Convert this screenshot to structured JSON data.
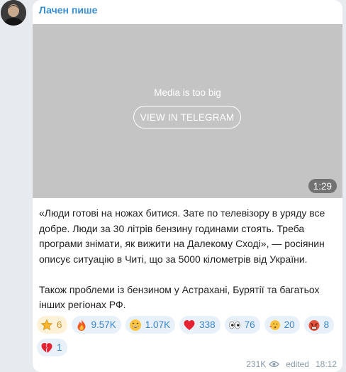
{
  "channel": {
    "name": "Лачен пише"
  },
  "media": {
    "notice": "Media is too big",
    "button_label": "VIEW IN TELEGRAM",
    "duration": "1:29"
  },
  "post": {
    "paragraph_1": "«Люди готові на ножах битися. Зате по телевізору в уряду все добре. Люди за 30 літрів бензину годинами стоять. Треба програми знімати, як вижити на Далекому Сході», — росіянин описує ситуацію в Читі, що за 5000 кілометрів від України.",
    "paragraph_2": "Також проблеми із бензином у Астрахані, Бурятії та багатьох інших регіонах РФ."
  },
  "reactions": [
    {
      "icon": "star-icon",
      "count": "6"
    },
    {
      "icon": "fire-icon",
      "count": "9.57K"
    },
    {
      "icon": "grin-face-icon",
      "count": "1.07K"
    },
    {
      "icon": "heart-icon",
      "count": "338"
    },
    {
      "icon": "eyes-icon",
      "count": "76"
    },
    {
      "icon": "kiss-face-icon",
      "count": "20"
    },
    {
      "icon": "angry-face-icon",
      "count": "8"
    },
    {
      "icon": "broken-heart-icon",
      "count": "1"
    }
  ],
  "meta": {
    "views": "231K",
    "edited_label": "edited",
    "time": "18:12"
  },
  "colors": {
    "accent": "#3a8ed2",
    "reaction_bg": "#e8f1fa",
    "paid_reaction_bg": "#fdf2d8",
    "background": "#e7ebf0"
  }
}
